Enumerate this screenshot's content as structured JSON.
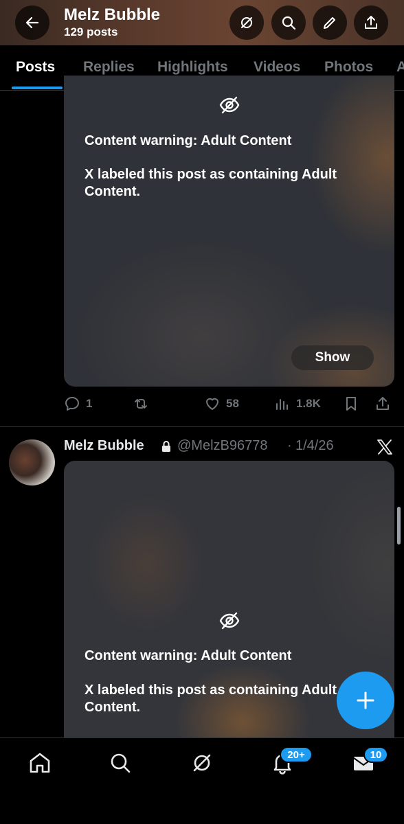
{
  "header": {
    "title": "Melz Bubble",
    "subtitle": "129 posts",
    "back_icon": "arrow-left-icon",
    "buttons": [
      "grok-icon",
      "search-icon",
      "edit-icon",
      "share-icon"
    ]
  },
  "tabs": [
    {
      "label": "Posts",
      "active": true
    },
    {
      "label": "Replies"
    },
    {
      "label": "Highlights"
    },
    {
      "label": "Videos"
    },
    {
      "label": "Photos"
    },
    {
      "label": "A"
    }
  ],
  "post1": {
    "warning_title": "Content warning: Adult Content",
    "warning_text": "X labeled this post as containing Adult Content.",
    "show_label": "Show",
    "actions": {
      "replies": "1",
      "reposts": "",
      "likes": "58",
      "views": "1.8K"
    }
  },
  "post2": {
    "name": "Melz Bubble",
    "handle": "@MelzB96778",
    "separator": "·",
    "date": "1/4/26",
    "warning_title": "Content warning: Adult Content",
    "warning_text": "X labeled this post as containing Adult Content."
  },
  "bottom_nav": {
    "notifications_badge": "20+",
    "messages_badge": "10"
  },
  "colors": {
    "accent": "#1d9bf0",
    "muted": "#71767b",
    "background": "#000000"
  }
}
